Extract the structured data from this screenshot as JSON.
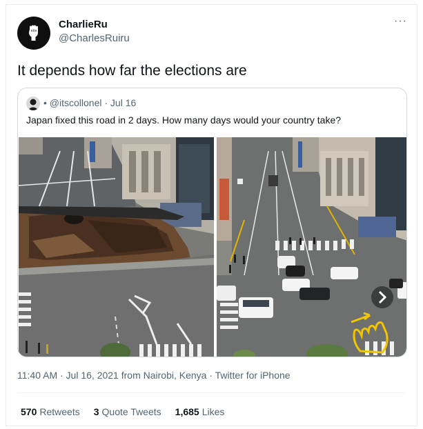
{
  "tweet": {
    "author_name": "CharlieRu",
    "author_handle": "@CharlesRuiru",
    "text": "It depends how far the elections are",
    "more_label": "···",
    "timestamp": "11:40 AM · Jul 16, 2021 from Nairobi, Kenya · Twitter for iPhone"
  },
  "quote": {
    "meta": "• @itscollonel · Jul 16",
    "text": "Japan fixed this road in 2 days. How many days would your country take?"
  },
  "stats": {
    "retweets_count": "570",
    "retweets_label": "Retweets",
    "quotes_count": "3",
    "quotes_label": "Quote Tweets",
    "likes_count": "1,685",
    "likes_label": "Likes"
  },
  "colors": {
    "text": "#0f1419",
    "secondary": "#536471",
    "border": "#cfd9de",
    "highlight": "#f2c500"
  }
}
